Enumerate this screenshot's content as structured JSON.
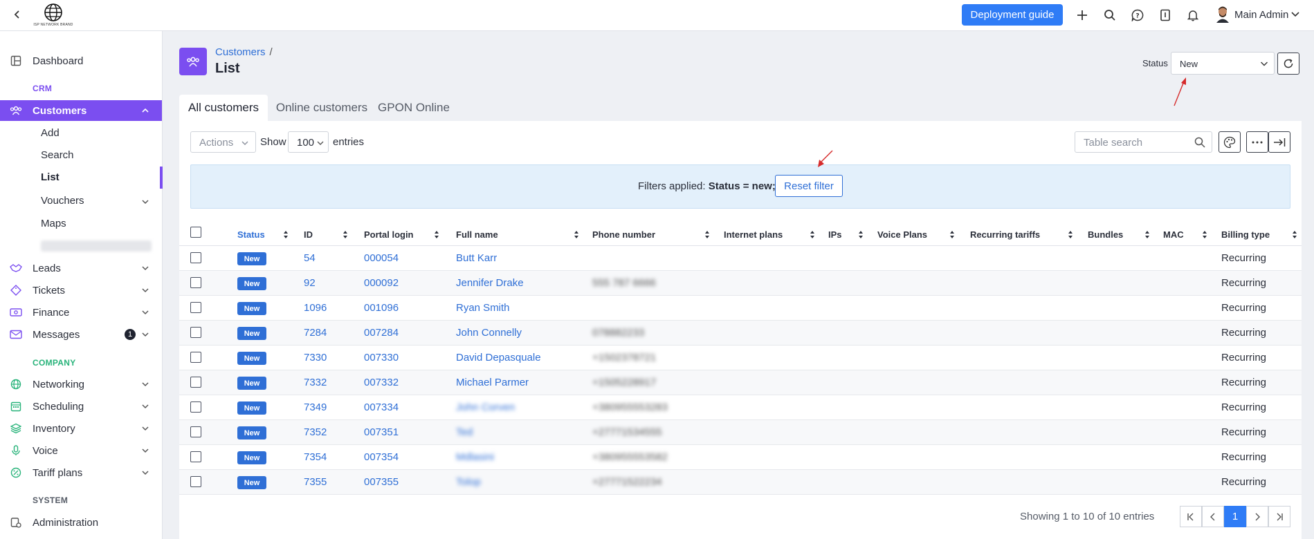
{
  "topbar": {
    "logo_caption": "ISP NETWORK BRAND",
    "deploy_label": "Deployment guide",
    "user_name": "Main Admin",
    "icons": [
      "back-icon",
      "plus-icon",
      "search-icon",
      "help-icon",
      "book-icon",
      "bell-icon",
      "chevron-down-icon"
    ]
  },
  "sidebar": {
    "dashboard": "Dashboard",
    "crm_section": "CRM",
    "customers": "Customers",
    "customers_sub": {
      "add": "Add",
      "search": "Search",
      "list": "List",
      "vouchers": "Vouchers",
      "maps": "Maps"
    },
    "leads": "Leads",
    "tickets": "Tickets",
    "finance": "Finance",
    "messages": "Messages",
    "messages_badge": "1",
    "company_section": "COMPANY",
    "networking": "Networking",
    "scheduling": "Scheduling",
    "inventory": "Inventory",
    "voice": "Voice",
    "tariff_plans": "Tariff plans",
    "system_section": "SYSTEM",
    "administration": "Administration"
  },
  "header": {
    "breadcrumb": "Customers",
    "breadcrumb_sep": "/",
    "title": "List",
    "status_label": "Status",
    "status_value": "New"
  },
  "tabs": [
    "All customers",
    "Online customers",
    "GPON Online"
  ],
  "toolbar": {
    "actions": "Actions",
    "show": "Show",
    "entries_value": "100",
    "entries": "entries",
    "search_placeholder": "Table search"
  },
  "filter": {
    "prefix": "Filters applied:",
    "value": "Status = new;",
    "reset": "Reset filter"
  },
  "table": {
    "columns": [
      "Status",
      "ID",
      "Portal login",
      "Full name",
      "Phone number",
      "Internet plans",
      "IPs",
      "Voice Plans",
      "Recurring tariffs",
      "Bundles",
      "MAC",
      "Billing type"
    ],
    "rows": [
      {
        "status": "New",
        "id": "54",
        "login": "000054",
        "name": "Butt Karr",
        "phone": "",
        "billing": "Recurring"
      },
      {
        "status": "New",
        "id": "92",
        "login": "000092",
        "name": "Jennifer Drake",
        "phone": "555 787 6666",
        "billing": "Recurring"
      },
      {
        "status": "New",
        "id": "1096",
        "login": "001096",
        "name": "Ryan Smith",
        "phone": "",
        "billing": "Recurring"
      },
      {
        "status": "New",
        "id": "7284",
        "login": "007284",
        "name": "John Connelly",
        "phone": "078882233",
        "billing": "Recurring"
      },
      {
        "status": "New",
        "id": "7330",
        "login": "007330",
        "name": "David Depasquale",
        "phone": "+1502378721",
        "billing": "Recurring"
      },
      {
        "status": "New",
        "id": "7332",
        "login": "007332",
        "name": "Michael Parmer",
        "phone": "+1505228917",
        "billing": "Recurring"
      },
      {
        "status": "New",
        "id": "7349",
        "login": "007334",
        "name": "John Corven",
        "phone": "+380955553283",
        "billing": "Recurring"
      },
      {
        "status": "New",
        "id": "7352",
        "login": "007351",
        "name": "Ted",
        "phone": "+27771534555",
        "billing": "Recurring"
      },
      {
        "status": "New",
        "id": "7354",
        "login": "007354",
        "name": "Mdlasini",
        "phone": "+380955553582",
        "billing": "Recurring"
      },
      {
        "status": "New",
        "id": "7355",
        "login": "007355",
        "name": "Tolop",
        "phone": "+27771522234",
        "billing": "Recurring"
      }
    ]
  },
  "pagination": {
    "info": "Showing 1 to 10 of 10 entries",
    "current": "1"
  },
  "colors": {
    "accent": "#7b4ef0",
    "primary": "#2f7cf6",
    "link": "#2f6fd6",
    "company": "#28b37a"
  }
}
